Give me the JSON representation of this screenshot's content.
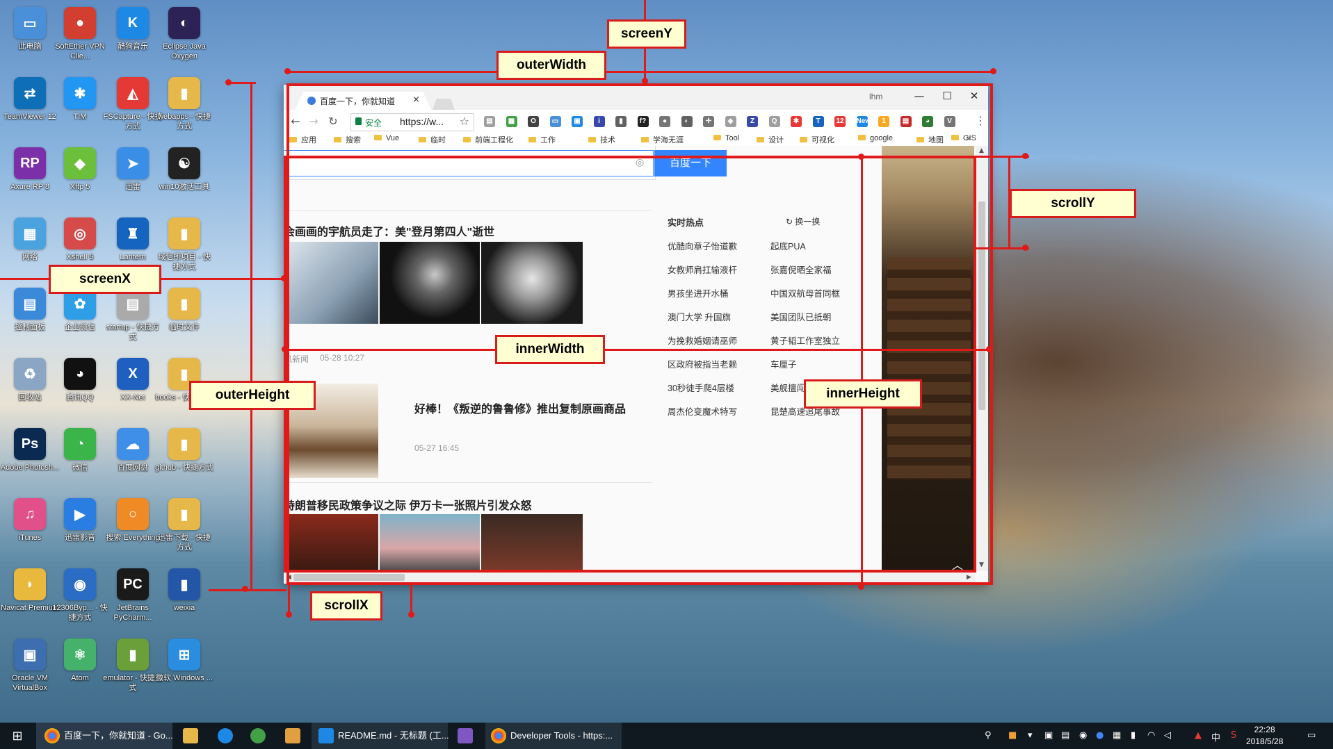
{
  "desktop": {
    "icons": [
      {
        "label": "此电脑",
        "color": "#4a90d9",
        "glyph": "▭"
      },
      {
        "label": "SoftEther VPN Clie...",
        "color": "#d23f31",
        "glyph": "●"
      },
      {
        "label": "酷狗音乐",
        "color": "#1e88e5",
        "glyph": "K"
      },
      {
        "label": "Eclipse Java Oxygen",
        "color": "#2c2255",
        "glyph": "◐"
      },
      {
        "label": "TeamViewer 12",
        "color": "#0e6eb8",
        "glyph": "⇄"
      },
      {
        "label": "TIM",
        "color": "#2196f3",
        "glyph": "✱"
      },
      {
        "label": "FSCapture - 快捷方式",
        "color": "#e53935",
        "glyph": "◭"
      },
      {
        "label": "webapps - 快捷方式",
        "color": "#e6b84a",
        "glyph": "▮"
      },
      {
        "label": "Axure RP 8",
        "color": "#7b2fa8",
        "glyph": "RP"
      },
      {
        "label": "Xftp 5",
        "color": "#6cbf3a",
        "glyph": "◆"
      },
      {
        "label": "迅雷",
        "color": "#3a8ee6",
        "glyph": "➤"
      },
      {
        "label": "win10激活工具",
        "color": "#222222",
        "glyph": "☯"
      },
      {
        "label": "网络",
        "color": "#4aa3df",
        "glyph": "▦"
      },
      {
        "label": "Xshell 5",
        "color": "#d64a4a",
        "glyph": "◎"
      },
      {
        "label": "Lantern",
        "color": "#1565c0",
        "glyph": "♜"
      },
      {
        "label": "域信所项目 - 快捷方式",
        "color": "#e6b84a",
        "glyph": "▮"
      },
      {
        "label": "控制面板",
        "color": "#3b8ad9",
        "glyph": "▤"
      },
      {
        "label": "企业微信",
        "color": "#2e9ee6",
        "glyph": "✿"
      },
      {
        "label": "startup - 快捷方式",
        "color": "#aaaaaa",
        "glyph": "▤"
      },
      {
        "label": "临时文件",
        "color": "#e6b84a",
        "glyph": "▮"
      },
      {
        "label": "回收站",
        "color": "#8aa6c4",
        "glyph": "♻"
      },
      {
        "label": "腾讯QQ",
        "color": "#111111",
        "glyph": "◕"
      },
      {
        "label": "XX-Net",
        "color": "#1f5fbf",
        "glyph": "X"
      },
      {
        "label": "books - 快捷方式",
        "color": "#e6b84a",
        "glyph": "▮"
      },
      {
        "label": "Adobe Photosh...",
        "color": "#0b2a52",
        "glyph": "Ps"
      },
      {
        "label": "微信",
        "color": "#3bb54a",
        "glyph": "◔"
      },
      {
        "label": "百度网盘",
        "color": "#3f8ee8",
        "glyph": "☁"
      },
      {
        "label": "github - 快捷方式",
        "color": "#e6b84a",
        "glyph": "▮"
      },
      {
        "label": "iTunes",
        "color": "#e2508a",
        "glyph": "♫"
      },
      {
        "label": "迅雷影音",
        "color": "#2a7de1",
        "glyph": "▶"
      },
      {
        "label": "搜索 Everything",
        "color": "#f08a24",
        "glyph": "○"
      },
      {
        "label": "迅雷下载 - 快捷方式",
        "color": "#e6b84a",
        "glyph": "▮"
      },
      {
        "label": "Navicat Premium",
        "color": "#e8b93c",
        "glyph": "◗"
      },
      {
        "label": "12306Byp... - 快捷方式",
        "color": "#2b6cc4",
        "glyph": "◉"
      },
      {
        "label": "JetBrains PyCharm...",
        "color": "#1a1a1a",
        "glyph": "PC"
      },
      {
        "label": "weixia",
        "color": "#2456a8",
        "glyph": "▮"
      },
      {
        "label": "Oracle VM VirtualBox",
        "color": "#3d6fb0",
        "glyph": "▣"
      },
      {
        "label": "Atom",
        "color": "#45b26b",
        "glyph": "⚛"
      },
      {
        "label": "emulator - 快捷方式",
        "color": "#6a9f3a",
        "glyph": "▮"
      },
      {
        "label": "微软 Windows ...",
        "color": "#2a8de0",
        "glyph": "⊞"
      }
    ]
  },
  "browser": {
    "tab_title": "百度一下，你就知道",
    "tab_close": "×",
    "user_name": "lhm",
    "window_controls": {
      "minimize": "—",
      "maximize": "☐",
      "close": "✕"
    },
    "nav": {
      "back": "←",
      "forward": "→",
      "reload": "↻"
    },
    "security_label": "安全",
    "url": "https://w...",
    "star": "☆",
    "menu": "⋮",
    "extensions": [
      {
        "name": "ext-1",
        "color": "#9e9e9e",
        "glyph": "▤"
      },
      {
        "name": "ext-2",
        "color": "#43a047",
        "glyph": "▦"
      },
      {
        "name": "ext-3",
        "color": "#424242",
        "glyph": "O"
      },
      {
        "name": "ext-4",
        "color": "#4a90d9",
        "glyph": "▭"
      },
      {
        "name": "ext-5",
        "color": "#1e88e5",
        "glyph": "▣"
      },
      {
        "name": "ext-6",
        "color": "#3949ab",
        "glyph": "i"
      },
      {
        "name": "ext-7",
        "color": "#616161",
        "glyph": "▮"
      },
      {
        "name": "ext-8",
        "color": "#212121",
        "glyph": "f?"
      },
      {
        "name": "ext-9",
        "color": "#757575",
        "glyph": "●"
      },
      {
        "name": "ext-10",
        "color": "#616161",
        "glyph": "◐"
      },
      {
        "name": "ext-11",
        "color": "#757575",
        "glyph": "✛"
      },
      {
        "name": "ext-12",
        "color": "#9e9e9e",
        "glyph": "◈"
      },
      {
        "name": "ext-13",
        "color": "#3949ab",
        "glyph": "Z"
      },
      {
        "name": "ext-14",
        "color": "#9e9e9e",
        "glyph": "Q"
      },
      {
        "name": "ext-15",
        "color": "#e53935",
        "glyph": "✱"
      },
      {
        "name": "ext-16",
        "color": "#1565c0",
        "glyph": "T"
      },
      {
        "name": "ext-17",
        "color": "#e53935",
        "glyph": "12"
      },
      {
        "name": "ext-18",
        "color": "#1e88e5",
        "glyph": "New"
      },
      {
        "name": "ext-19",
        "color": "#f9a825",
        "glyph": "1"
      },
      {
        "name": "ext-20",
        "color": "#c62828",
        "glyph": "▤"
      },
      {
        "name": "ext-21",
        "color": "#2e7d32",
        "glyph": "◕"
      },
      {
        "name": "ext-22",
        "color": "#757575",
        "glyph": "V"
      }
    ],
    "bookmarks": [
      "应用",
      "搜索",
      "Vue",
      "临时",
      "前端工程化",
      "工作",
      "技术",
      "学海无涯",
      "Tool",
      "设计",
      "可视化",
      "google",
      "地图",
      "GIS"
    ],
    "bookmarks_more": "»"
  },
  "page": {
    "search_button": "百度一下",
    "camera_icon": "◎",
    "news1_title": "会画画的宇航员走了：美\"登月第四人\"逝世",
    "news1_source": "凤新闻",
    "news1_time": "05-28 10:27",
    "news2_title": "好棒！《叛逆的鲁鲁修》推出复制原画商品",
    "news2_time": "05-27 16:45",
    "news3_title": "特朗普移民政策争议之际 伊万卡一张照片引发众怒",
    "hot_title": "实时热点",
    "hot_refresh": "换一换",
    "hot_items": [
      "优酷向章子怡道歉",
      "起底PUA",
      "女教师肩扛输液杆",
      "张嘉倪晒全家福",
      "男孩坐进开水桶",
      "中国双航母首同框",
      "澳门大学 升国旗",
      "美国团队已抵朝",
      "为挽救婚姻请巫师",
      "黄子韬工作室独立",
      "区政府被指当老赖",
      "车厘子",
      "30秒徒手爬4层楼",
      "美舰擅闯中国西沙",
      "周杰伦变魔术特写",
      "昆楚高速追尾事故"
    ],
    "to_top": "︿"
  },
  "annotations": {
    "screenY": "screenY",
    "outerWidth": "outerWidth",
    "scrollY": "scrollY",
    "screenX": "screenX",
    "innerWidth": "innerWidth",
    "outerHeight": "outerHeight",
    "innerHeight": "innerHeight",
    "scrollX": "scrollX"
  },
  "taskbar": {
    "items": [
      {
        "label": "百度一下，你就知道 - Go..."
      },
      {
        "label": "README.md - 无标题 (工..."
      },
      {
        "label": "Developer Tools - https:..."
      }
    ],
    "ime": "中",
    "time": "22:28",
    "date": "2018/5/28"
  }
}
